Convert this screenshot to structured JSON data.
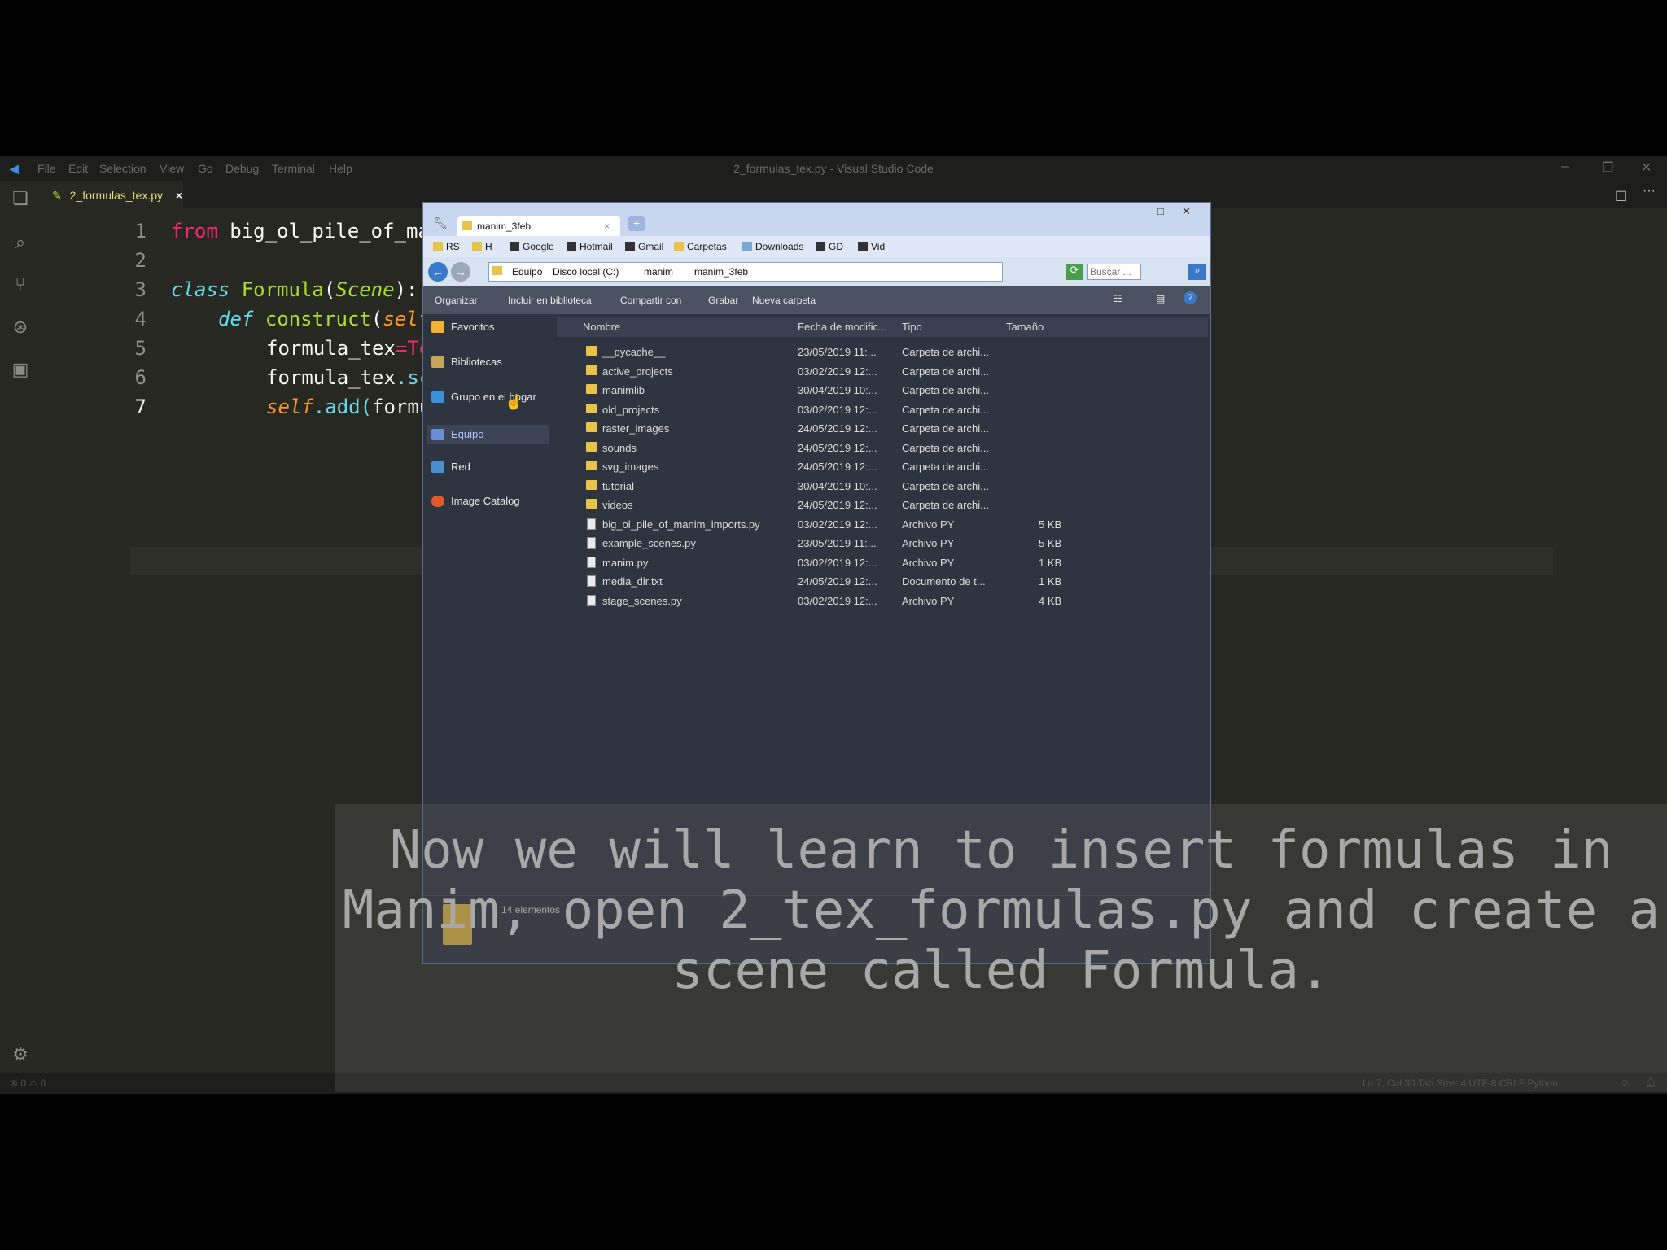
{
  "vscode": {
    "title": "2_formulas_tex.py - Visual Studio Code",
    "menu": [
      "File",
      "Edit",
      "Selection",
      "View",
      "Go",
      "Debug",
      "Terminal",
      "Help"
    ],
    "tab_label": "2_formulas_tex.py",
    "tab_close": "×",
    "line_numbers": [
      "1",
      "2",
      "3",
      "4",
      "5",
      "6",
      "7"
    ],
    "code": {
      "l1_kw": "from",
      "l1_rest": " big_ol_pile_of_manin",
      "l3_kw": "class",
      "l3_name": "Formula",
      "l3_p1": "(",
      "l3_base": "Scene",
      "l3_p2": "):",
      "l4_kw": "def",
      "l4_name": "construct",
      "l4_p1": "(",
      "l4_self": "self",
      "l4_p2": "):",
      "l5_a": "formula_tex",
      "l5_op": "=",
      "l5_b": "TexMo",
      "l6_a": "formula_tex",
      "l6_b": ".scale",
      "l7_self": "self",
      "l7_b": ".add(",
      "l7_c": "formula_"
    },
    "status": {
      "problems": "⊗ 0 ⚠ 0",
      "right": "Ln 7, Col 30    Tab Size: 4    UTF-8    CRLF    Python"
    }
  },
  "explorer": {
    "tab_title": "manim_3feb",
    "tab_close": "×",
    "new_tab": "+",
    "window_controls": [
      "–",
      "□",
      "✕"
    ],
    "bookmarks": [
      "RS",
      "H",
      "Google",
      "Hotmail",
      "Gmail",
      "Carpetas",
      "Downloads",
      "GD",
      "Vid"
    ],
    "address_crumbs": [
      "Equipo",
      "Disco local (C:)",
      "manim",
      "manim_3feb"
    ],
    "search_placeholder": "Buscar ...",
    "toolbar": [
      "Organizar",
      "Incluir en biblioteca",
      "Compartir con",
      "Grabar",
      "Nueva carpeta"
    ],
    "nav": [
      {
        "label": "Favoritos",
        "icon": "star-icon",
        "color": "#f2b233"
      },
      {
        "label": "Bibliotecas",
        "icon": "library-icon",
        "color": "#c8a45a"
      },
      {
        "label": "Grupo en el hogar",
        "icon": "homegroup-icon",
        "color": "#3a8fd6"
      },
      {
        "label": "Equipo",
        "icon": "computer-icon",
        "color": "#6a8fd0"
      },
      {
        "label": "Red",
        "icon": "network-icon",
        "color": "#4a8fd0"
      },
      {
        "label": "Image Catalog",
        "icon": "catalog-icon",
        "color": "#e25a2c"
      }
    ],
    "columns": [
      "Nombre",
      "Fecha de modific...",
      "Tipo",
      "Tamaño"
    ],
    "files": [
      {
        "name": "__pycache__",
        "date": "23/05/2019 11:...",
        "type": "Carpeta de archi...",
        "size": "",
        "kind": "folder"
      },
      {
        "name": "active_projects",
        "date": "03/02/2019 12:...",
        "type": "Carpeta de archi...",
        "size": "",
        "kind": "folder"
      },
      {
        "name": "manimlib",
        "date": "30/04/2019 10:...",
        "type": "Carpeta de archi...",
        "size": "",
        "kind": "folder"
      },
      {
        "name": "old_projects",
        "date": "03/02/2019 12:...",
        "type": "Carpeta de archi...",
        "size": "",
        "kind": "folder"
      },
      {
        "name": "raster_images",
        "date": "24/05/2019 12:...",
        "type": "Carpeta de archi...",
        "size": "",
        "kind": "folder"
      },
      {
        "name": "sounds",
        "date": "24/05/2019 12:...",
        "type": "Carpeta de archi...",
        "size": "",
        "kind": "folder"
      },
      {
        "name": "svg_images",
        "date": "24/05/2019 12:...",
        "type": "Carpeta de archi...",
        "size": "",
        "kind": "folder"
      },
      {
        "name": "tutorial",
        "date": "30/04/2019 10:...",
        "type": "Carpeta de archi...",
        "size": "",
        "kind": "folder"
      },
      {
        "name": "videos",
        "date": "24/05/2019 12:...",
        "type": "Carpeta de archi...",
        "size": "",
        "kind": "folder"
      },
      {
        "name": "big_ol_pile_of_manim_imports.py",
        "date": "03/02/2019 12:...",
        "type": "Archivo PY",
        "size": "5 KB",
        "kind": "py"
      },
      {
        "name": "example_scenes.py",
        "date": "23/05/2019 11:...",
        "type": "Archivo PY",
        "size": "5 KB",
        "kind": "py"
      },
      {
        "name": "manim.py",
        "date": "03/02/2019 12:...",
        "type": "Archivo PY",
        "size": "1 KB",
        "kind": "py"
      },
      {
        "name": "media_dir.txt",
        "date": "24/05/2019 12:...",
        "type": "Documento de t...",
        "size": "1 KB",
        "kind": "txt"
      },
      {
        "name": "stage_scenes.py",
        "date": "03/02/2019 12:...",
        "type": "Archivo PY",
        "size": "4 KB",
        "kind": "py"
      }
    ],
    "status": "14 elementos"
  },
  "subtitle": "Now we will learn to insert formulas in Manim, open 2_tex_formulas.py and create a scene called Formula."
}
